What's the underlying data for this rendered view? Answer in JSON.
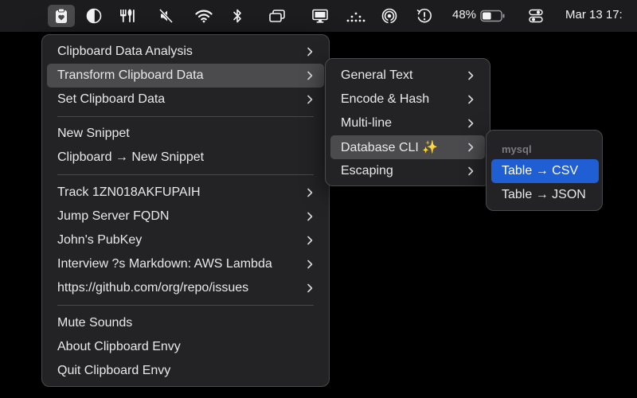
{
  "menubar": {
    "icons": [
      {
        "name": "clipboard-envy-icon",
        "active": true
      },
      {
        "name": "contrast-circle-icon"
      },
      {
        "name": "utensils-icon"
      },
      {
        "name": "mute-icon"
      },
      {
        "name": "wifi-icon"
      },
      {
        "name": "bluetooth-icon"
      },
      {
        "name": "windows-icon"
      },
      {
        "name": "display-icon"
      },
      {
        "name": "dots-loader-icon"
      },
      {
        "name": "airdrop-icon"
      },
      {
        "name": "clock-alert-icon"
      },
      {
        "name": "battery-icon"
      },
      {
        "name": "control-center-icon"
      }
    ],
    "battery_percent": "48%",
    "battery_level": 0.48,
    "date_time": "Mar 13  17:"
  },
  "main_menu": {
    "groups": [
      [
        {
          "label": "Clipboard Data Analysis",
          "submenu": true
        },
        {
          "label": "Transform Clipboard Data",
          "submenu": true,
          "highlighted": true
        },
        {
          "label": "Set Clipboard Data",
          "submenu": true
        }
      ],
      [
        {
          "label": "New Snippet",
          "submenu": false
        },
        {
          "label": "Clipboard → New Snippet",
          "submenu": false
        }
      ],
      [
        {
          "label": "Track 1ZN018AKFUPAIH",
          "submenu": true
        },
        {
          "label": "Jump Server FQDN",
          "submenu": true
        },
        {
          "label": "John's PubKey",
          "submenu": true
        },
        {
          "label": "Interview ?s Markdown: AWS Lambda",
          "submenu": true
        },
        {
          "label": "https://github.com/org/repo/issues",
          "submenu": true
        }
      ],
      [
        {
          "label": "Mute Sounds",
          "submenu": false
        },
        {
          "label": "About Clipboard Envy",
          "submenu": false
        },
        {
          "label": "Quit Clipboard Envy",
          "submenu": false
        }
      ]
    ]
  },
  "transform_menu": {
    "items": [
      {
        "label": "General Text",
        "submenu": true
      },
      {
        "label": "Encode & Hash",
        "submenu": true
      },
      {
        "label": "Multi-line",
        "submenu": true
      },
      {
        "label": "Database CLI ✨",
        "submenu": true,
        "highlighted": true
      },
      {
        "label": "Escaping",
        "submenu": true
      }
    ]
  },
  "database_menu": {
    "section_header": "mysql",
    "items": [
      {
        "label": "Table → CSV",
        "selected": true
      },
      {
        "label": "Table → JSON",
        "selected": false
      }
    ]
  },
  "colors": {
    "menubar_bg": "#1c1c1e",
    "menu_bg": "#232325",
    "highlight": "#4b4b4e",
    "selection_blue": "#1f5fd3",
    "desktop": "#000000"
  }
}
